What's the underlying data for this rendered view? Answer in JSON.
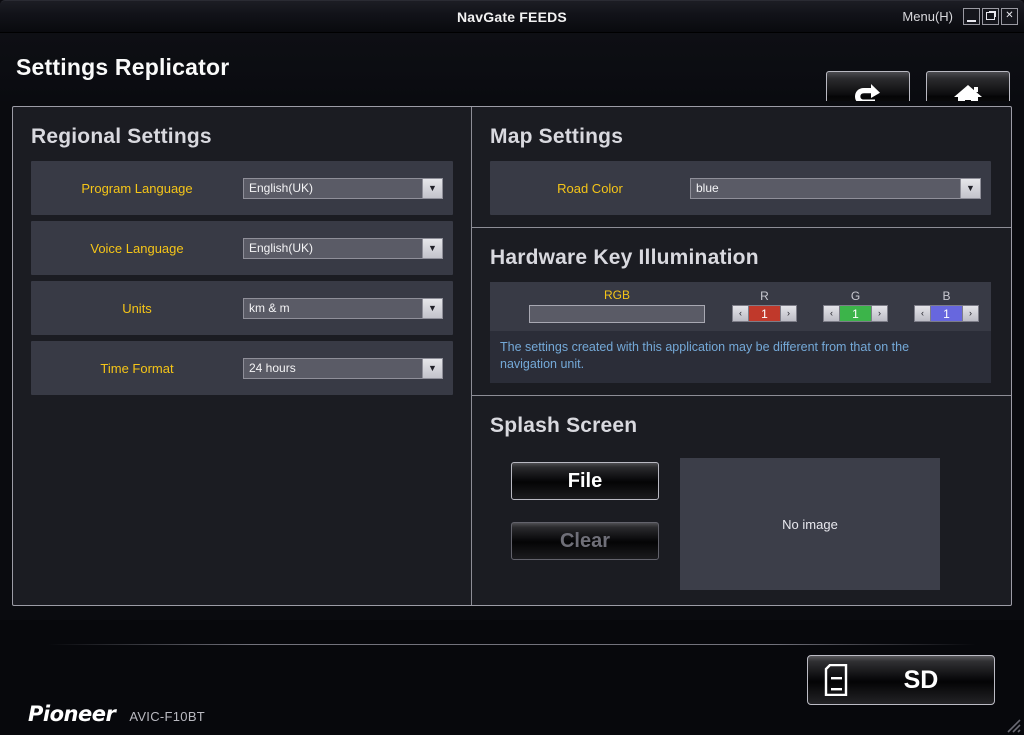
{
  "window": {
    "title": "NavGate FEEDS",
    "menu_label": "Menu(H)",
    "menu_mnemonic": "H",
    "controls": {
      "minimize": "minimize-icon",
      "restore": "restore-icon",
      "close": "✕"
    }
  },
  "header": {
    "page_title": "Settings Replicator",
    "back_button": "back-icon",
    "home_button": "home-icon"
  },
  "regional": {
    "title": "Regional Settings",
    "rows": [
      {
        "label": "Program Language",
        "value": "English(UK)"
      },
      {
        "label": "Voice Language",
        "value": "English(UK)"
      },
      {
        "label": "Units",
        "value": "km & m"
      },
      {
        "label": "Time Format",
        "value": "24 hours"
      }
    ]
  },
  "map": {
    "title": "Map Settings",
    "rows": [
      {
        "label": "Road Color",
        "value": "blue"
      }
    ]
  },
  "illumination": {
    "title": "Hardware Key Illumination",
    "rgb_caption": "RGB",
    "rgb_value": "",
    "channels": [
      {
        "label": "R",
        "value": "1",
        "color": "#c0392b",
        "dec": "‹",
        "inc": "›"
      },
      {
        "label": "G",
        "value": "1",
        "color": "#3cb44a",
        "dec": "‹",
        "inc": "›"
      },
      {
        "label": "B",
        "value": "1",
        "color": "#6767de",
        "dec": "‹",
        "inc": "›"
      }
    ],
    "note": "The settings created with this application may be different from that on the navigation unit."
  },
  "splash": {
    "title": "Splash Screen",
    "file_button": "File",
    "clear_button": "Clear",
    "preview_text": "No image"
  },
  "footer": {
    "sd_button": "SD",
    "sd_icon": "sd-card-icon",
    "brand": "Pioneer",
    "model": "AVIC-F10BT"
  },
  "colors": {
    "accent_label": "#f5c518",
    "note": "#74a9d8",
    "panel": "#383a45",
    "frame_border": "#9c9ca6"
  }
}
